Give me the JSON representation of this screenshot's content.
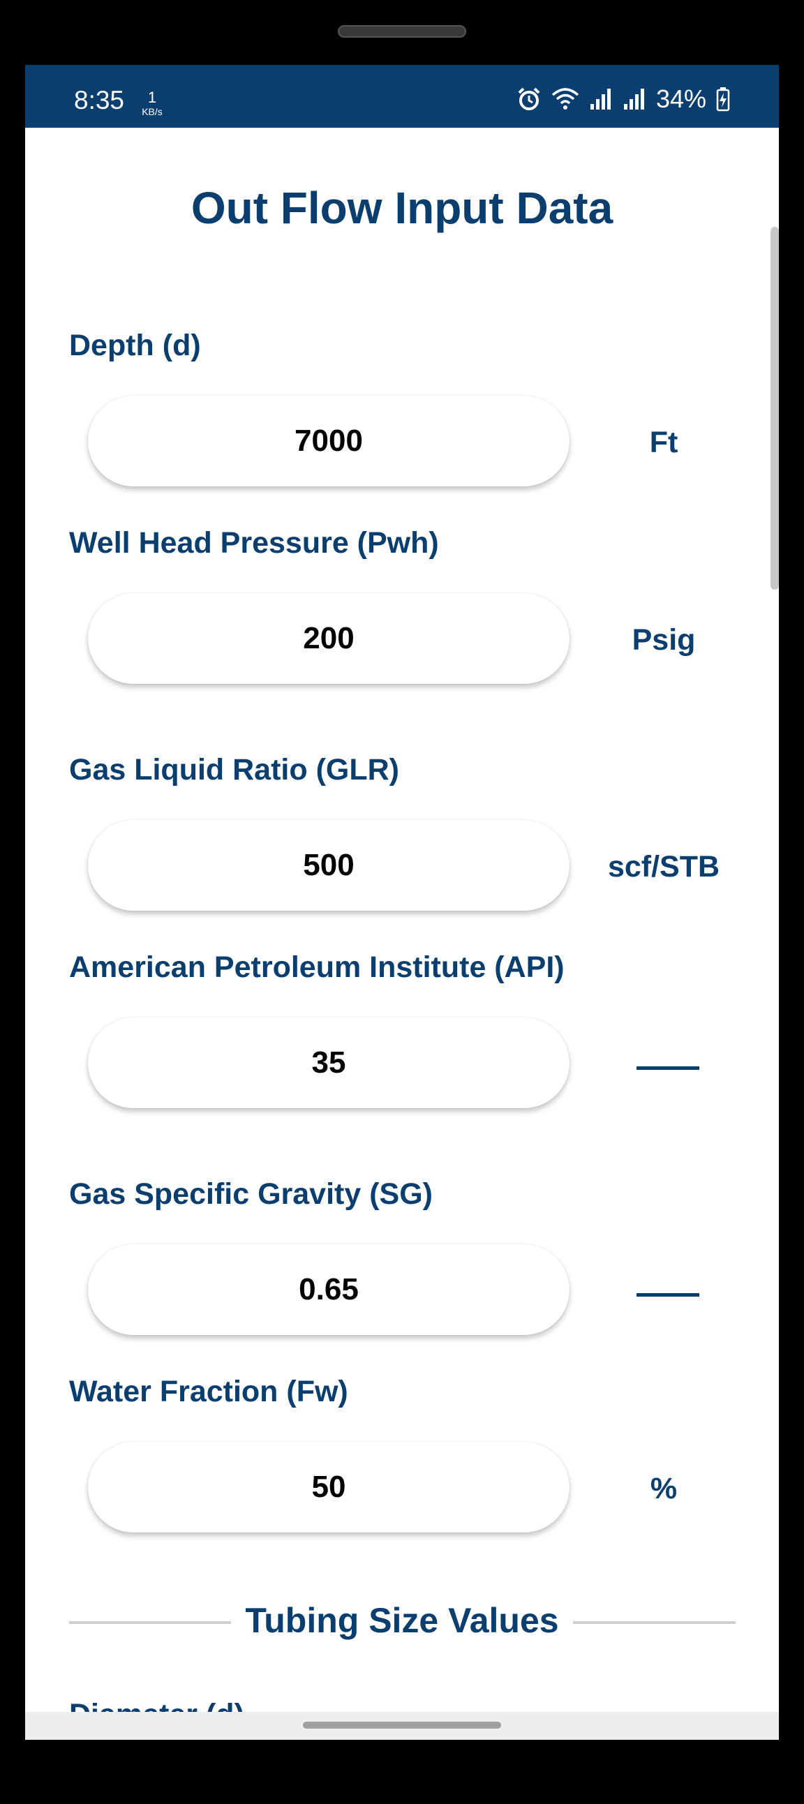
{
  "status_bar": {
    "time": "8:35",
    "net_speed_value": "1",
    "net_speed_unit": "KB/s",
    "battery_percent": "34%",
    "icons": [
      "alarm-icon",
      "wifi-icon",
      "signal-icon",
      "signal-icon",
      "battery-charging-icon"
    ]
  },
  "page": {
    "title": "Out Flow Input Data"
  },
  "fields": [
    {
      "label": "Depth (d)",
      "value": "7000",
      "unit": "Ft"
    },
    {
      "label": "Well Head Pressure (Pwh)",
      "value": "200",
      "unit": "Psig"
    },
    {
      "label": "Gas Liquid Ratio (GLR)",
      "value": "500",
      "unit": "scf/STB"
    },
    {
      "label": "American Petroleum Institute (API)",
      "value": "35",
      "unit": ""
    },
    {
      "label": "Gas Specific Gravity (SG)",
      "value": "0.65",
      "unit": ""
    },
    {
      "label": "Water Fraction (Fw)",
      "value": "50",
      "unit": "%"
    }
  ],
  "tubing_section": {
    "title": "Tubing Size Values",
    "next_label": "Diameter (d)"
  },
  "colors": {
    "primary": "#0a3e6e",
    "background": "#ffffff",
    "divider": "#d0d0d0"
  }
}
